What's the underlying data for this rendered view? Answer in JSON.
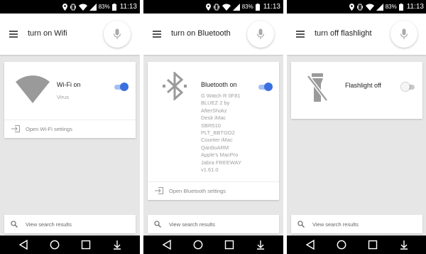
{
  "status_bar": {
    "battery": "83%",
    "time": "11:13"
  },
  "panels": [
    {
      "query": "turn on Wifi",
      "card_title": "Wi-Fi on",
      "card_subtitle": [
        "Virus"
      ],
      "icon": "wifi-icon",
      "toggle_on": true,
      "settings_link": "Open Wi-Fi settings"
    },
    {
      "query": "turn on Bluetooth",
      "card_title": "Bluetooth on",
      "card_subtitle": [
        "G Watch R 0F81",
        "BLUEZ 2 by",
        "AfterShokz",
        "Desk iMac",
        "SBR510",
        "PLT_BBTGO2",
        "Counter iMac",
        "QardioARM",
        "Apple's MacPro",
        "Jabra FREEWAY",
        "v1.61.0"
      ],
      "icon": "bluetooth-icon",
      "toggle_on": true,
      "settings_link": "Open Bluetooth settings"
    },
    {
      "query": "turn off flashlight",
      "card_title": "Flashlight off",
      "card_subtitle": [],
      "icon": "flashlight-off-icon",
      "toggle_on": false,
      "settings_link": ""
    }
  ],
  "search_results_label": "View search results",
  "colors": {
    "accent": "#3a70e0",
    "icon_gray": "#9a9a9a",
    "background": "#e6e6e6"
  }
}
